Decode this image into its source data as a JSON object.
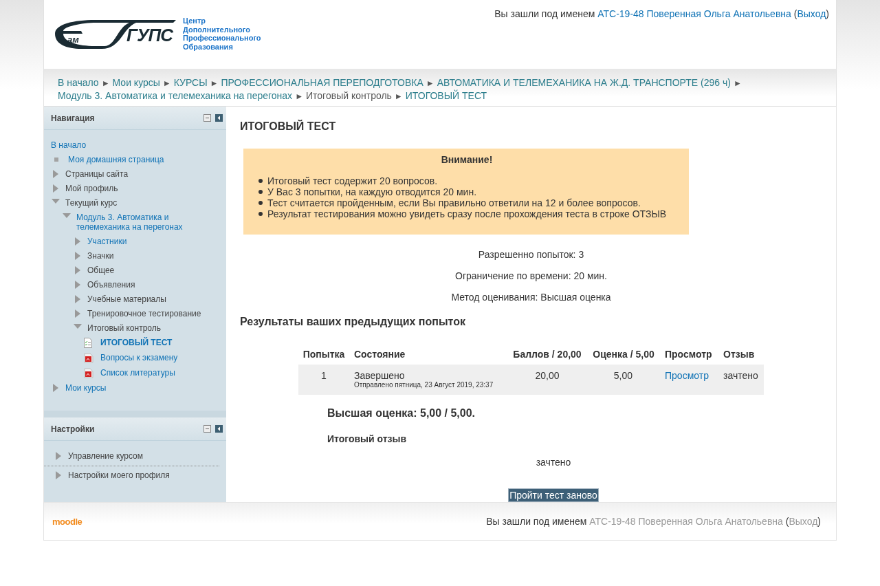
{
  "header": {
    "logo": {
      "mark_small": "ам",
      "mark_big": "ГУПС",
      "tagline": [
        "Центр",
        "Дополнительного",
        "Профессионального",
        "Образования"
      ]
    },
    "login": [
      {
        "text": "Вы зашли под именем ",
        "link": false
      },
      {
        "text": "АТС-19-48 Поверенная Ольга Анатольевна",
        "link": true
      },
      {
        "text": " (",
        "link": false
      },
      {
        "text": "Выход",
        "link": true
      },
      {
        "text": ")",
        "link": false
      }
    ]
  },
  "breadcrumb": [
    {
      "label": "В начало"
    },
    {
      "sep": "►",
      "label": "Мои курсы"
    },
    {
      "sep": "►",
      "label": "КУРСЫ"
    },
    {
      "sep": "►",
      "label": "ПРОФЕССИОНАЛЬНАЯ ПЕРЕПОДГОТОВКА"
    },
    {
      "sep": "►",
      "label": "АВТОМАТИКА И ТЕЛЕМЕХАНИКА НА Ж.Д. ТРАНСПОРТЕ (296 ч)"
    },
    {
      "sep": "►",
      "label": "Модуль 3. Автоматика и телемеханика на перегонах"
    },
    {
      "sep": "►",
      "label": "Итоговый контроль",
      "link": false
    },
    {
      "sep": "►",
      "label": "ИТОГОВЫЙ ТЕСТ"
    }
  ],
  "navigation": {
    "title": "Навигация",
    "home": "В начало",
    "items": [
      {
        "kind": "leaf",
        "label": "Моя домашняя страница",
        "link": true
      },
      {
        "kind": "branch",
        "label": "Страницы сайта",
        "link": false,
        "expanded": false
      },
      {
        "kind": "branch",
        "label": "Мой профиль",
        "link": false,
        "expanded": false
      },
      {
        "kind": "branch",
        "label": "Текущий курс",
        "link": false,
        "expanded": true,
        "children": [
          {
            "kind": "branch",
            "label": "Модуль 3. Автоматика и телемеханика на перегонах",
            "link": true,
            "expanded": true,
            "children": [
              {
                "kind": "branch",
                "label": "Участники",
                "link": true,
                "expanded": false
              },
              {
                "kind": "branch",
                "label": "Значки",
                "link": false,
                "expanded": false
              },
              {
                "kind": "branch",
                "label": "Общее",
                "link": false,
                "expanded": false
              },
              {
                "kind": "branch",
                "label": "Объявления",
                "link": false,
                "expanded": false
              },
              {
                "kind": "branch",
                "label": "Учебные материалы",
                "link": false,
                "expanded": false
              },
              {
                "kind": "branch",
                "label": "Тренировочное тестирование",
                "link": false,
                "expanded": false
              },
              {
                "kind": "branch",
                "label": "Итоговый контроль",
                "link": false,
                "expanded": true,
                "children": [
                  {
                    "kind": "quiz",
                    "label": "ИТОГОВЫЙ ТЕСТ",
                    "link": true,
                    "selected": true
                  },
                  {
                    "kind": "pdf",
                    "label": "Вопросы к экзамену",
                    "link": true,
                    "selected": false
                  },
                  {
                    "kind": "pdf",
                    "label": "Список литературы",
                    "link": true,
                    "selected": false
                  }
                ]
              }
            ]
          }
        ]
      },
      {
        "kind": "branch",
        "label": "Мои курсы",
        "link": true,
        "expanded": false
      }
    ]
  },
  "settings": {
    "title": "Настройки",
    "items": [
      {
        "label": "Управление курсом",
        "expanded": false
      },
      {
        "label": "Настройки моего профиля",
        "expanded": false
      }
    ]
  },
  "main": {
    "title": "ИТОГОВЫЙ ТЕСТ",
    "notice": {
      "title": "Внимание!",
      "items": [
        "Итоговый тест содержит 20 вопросов.",
        "У Вас 3 попытки, на каждую отводится 20 мин.",
        "Тест считается пройденным, если Вы правильно ответили на 12 и более вопросов.",
        "Результат тестирования можно увидеть сразу после прохождения теста в строке ОТЗЫВ"
      ]
    },
    "info": [
      "Разрешенно попыток: 3",
      "Ограничение по времени: 20 мин.",
      "Метод оценивания: Высшая оценка"
    ],
    "results_title": "Результаты ваших предыдущих попыток",
    "table": {
      "columns": [
        "Попытка",
        "Состояние",
        "Баллов / 20,00",
        "Оценка / 5,00",
        "Просмотр",
        "Отзыв"
      ],
      "rows": [
        {
          "attempt": "1",
          "state": "Завершено",
          "submitted": "Отправлено пятница, 23 Август 2019, 23:37",
          "points": "20,00",
          "grade": "5,00",
          "review": "Просмотр",
          "feedback": "зачтено"
        }
      ]
    },
    "best": "Высшая оценка: 5,00 / 5,00.",
    "feedback_title": "Итоговый отзыв",
    "feedback": "зачтено",
    "retry_button": "Пройти тест заново"
  },
  "footer": {
    "logo": "moodle",
    "login": [
      {
        "text": "Вы зашли под именем ",
        "link": false
      },
      {
        "text": "АТС-19-48 Поверенная Ольга Анатольевна",
        "link": true
      },
      {
        "text": " (",
        "link": false
      },
      {
        "text": "Выход",
        "link": true
      },
      {
        "text": ")",
        "link": false
      }
    ]
  }
}
